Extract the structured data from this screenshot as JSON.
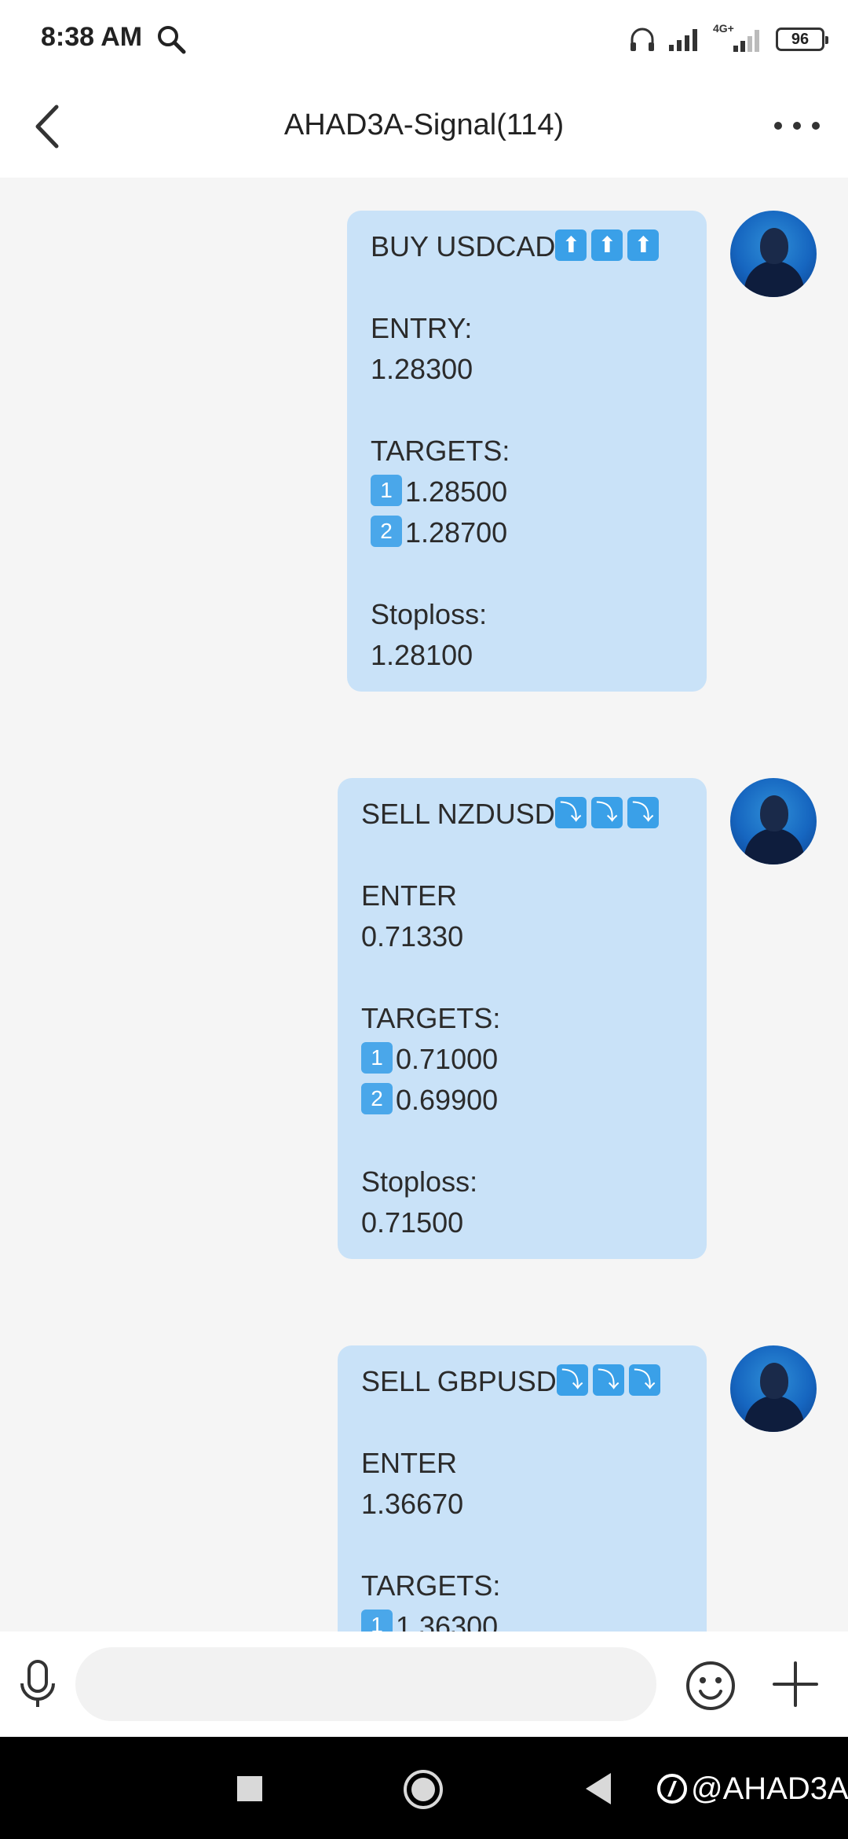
{
  "status_bar": {
    "time": "8:38 AM",
    "network": "4G+",
    "battery": "96"
  },
  "header": {
    "title": "AHAD3A-Signal(114)"
  },
  "messages": [
    {
      "title": "BUY USDCAD",
      "title_arrows": "⬆",
      "entry_label": "ENTRY:",
      "entry_value": "1.28300",
      "targets_label": "TARGETS:",
      "t1_num": "1",
      "t1": "1.28500",
      "t2_num": "2",
      "t2": "1.28700",
      "stop_label": "Stoploss:",
      "stop_value": "1.28100"
    },
    {
      "title": "SELL NZDUSD",
      "title_arrows": "⤵",
      "entry_label": "ENTER",
      "entry_value": "0.71330",
      "targets_label": "TARGETS:",
      "t1_num": "1",
      "t1": "0.71000",
      "t2_num": "2",
      "t2": "0.69900",
      "stop_label": "Stoploss:",
      "stop_value": "0.71500"
    },
    {
      "title": "SELL GBPUSD",
      "title_arrows": "⤵",
      "entry_label": "ENTER",
      "entry_value": "1.36670",
      "targets_label": "TARGETS:",
      "t1_num": "1",
      "t1": "1.36300"
    }
  ],
  "watermark": "@AHAD3A",
  "colors": {
    "bubble": "#c9e2f8",
    "emoji": "#3aa0e8",
    "navbar": "#000000"
  }
}
